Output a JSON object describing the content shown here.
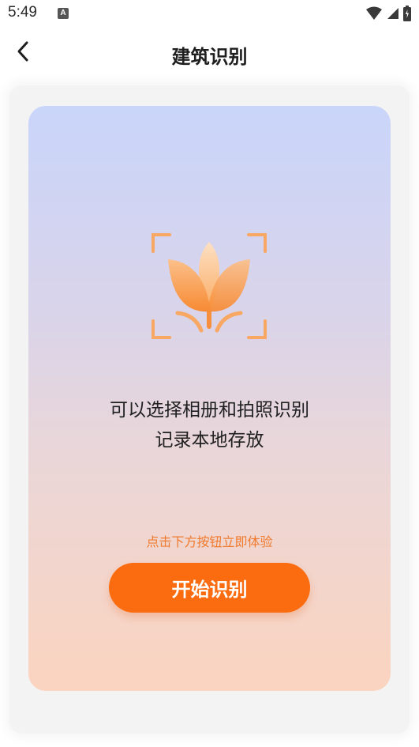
{
  "status_bar": {
    "time": "5:49",
    "notification_letter": "A",
    "icons": [
      "wifi-icon",
      "signal-icon",
      "battery-icon"
    ]
  },
  "header": {
    "title": "建筑识别",
    "back_icon": "chevron-left-icon"
  },
  "main": {
    "icon": "flower-scan-icon",
    "description_line1": "可以选择相册和拍照识别",
    "description_line2": "记录本地存放",
    "hint": "点击下方按钮立即体验",
    "start_button_label": "开始识别"
  },
  "colors": {
    "accent": "#fb6c10",
    "hint_text": "#f07a2e",
    "card_gradient_top": "#c9d5fa",
    "card_gradient_bottom": "#fbd4bf"
  }
}
